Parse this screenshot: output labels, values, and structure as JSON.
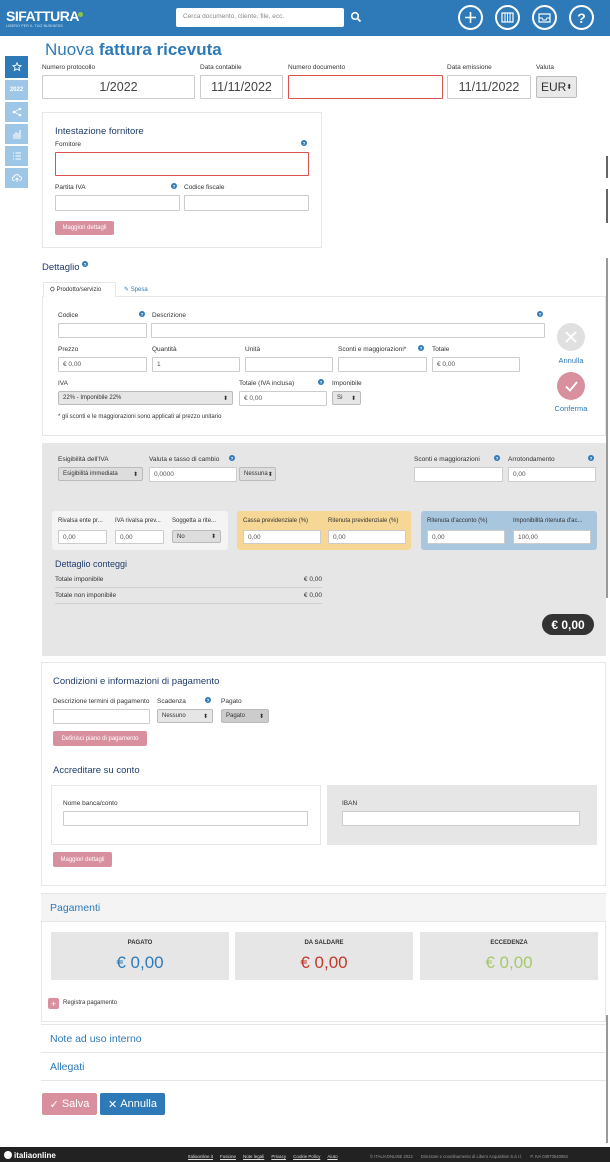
{
  "topbar": {
    "logo": "SIFATTURA",
    "tagline": "LIBERO PER IL TUO BUSINESS",
    "search_placeholder": "Cerca documento, cliente, file, ecc."
  },
  "sidebar": {
    "year": "2022"
  },
  "page": {
    "title_light": "Nuova ",
    "title_bold": "fattura ricevuta"
  },
  "header_fields": {
    "protocol_label": "Numero protocollo",
    "protocol_value": "1/2022",
    "accounting_date_label": "Data contabile",
    "accounting_date_value": "11/11/2022",
    "doc_number_label": "Numero documento",
    "doc_number_value": "",
    "issue_date_label": "Data emissione",
    "issue_date_value": "11/11/2022",
    "currency_label": "Valuta",
    "currency_value": "EUR"
  },
  "supplier": {
    "title": "Intestazione fornitore",
    "supplier_label": "Fornitore",
    "vat_label": "Partita IVA",
    "tax_code_label": "Codice fiscale",
    "more_button": "Maggiori dettagli"
  },
  "detail": {
    "title": "Dettaglio",
    "tab_product": "Prodotto/servizio",
    "tab_expense": "Spesa",
    "code_label": "Codice",
    "desc_label": "Descrizione",
    "price_label": "Prezzo",
    "price_value": "€ 0,00",
    "qty_label": "Quantità",
    "qty_value": "1",
    "unit_label": "Unità",
    "discount_label": "Sconti e maggiorazioni*",
    "total_label": "Totale",
    "total_value": "€ 0,00",
    "vat_label": "IVA",
    "vat_value": "22% - Imponibile 22%",
    "total_vat_label": "Totale (IVA inclusa)",
    "total_vat_value": "€ 0,00",
    "taxable_label": "Imponibile",
    "taxable_value": "Sì",
    "note": "* gli sconti e le maggiorazioni sono applicati al prezzo unitario",
    "cancel": "Annulla",
    "confirm": "Conferma"
  },
  "settings": {
    "vat_eligibility_label": "Esigibilità dell'IVA",
    "vat_eligibility_value": "Esigibilità immediata",
    "currency_rate_label": "Valuta e tasso di cambio",
    "currency_rate_value": "0,0000",
    "currency_select": "Nessuna",
    "discounts_label": "Sconti e maggiorazioni",
    "rounding_label": "Arrotondamento",
    "rounding_value": "0,00",
    "rivalsa_label": "Rivalsa ente pr...",
    "rivalsa_value": "0,00",
    "iva_rivalsa_label": "IVA rivalsa prev...",
    "iva_rivalsa_value": "0,00",
    "soggetta_label": "Soggetta a rite...",
    "soggetta_value": "No",
    "cassa_label": "Cassa previdenziale (%)",
    "cassa_value": "0,00",
    "rit_prev_label": "Ritenuta previdenziale (%)",
    "rit_prev_value": "0,00",
    "rit_acconto_label": "Ritenuta d'acconto (%)",
    "rit_acconto_value": "0,00",
    "imponibilita_label": "Imponibilità ritenuta d'ac...",
    "imponibilita_value": "100,00"
  },
  "summary": {
    "title": "Dettaglio conteggi",
    "taxable_label": "Totale imponibile",
    "taxable_value": "€ 0,00",
    "non_taxable_label": "Totale non imponibile",
    "non_taxable_value": "€ 0,00",
    "grand_total": "€ 0,00"
  },
  "payment": {
    "title": "Condizioni e informazioni di pagamento",
    "terms_label": "Descrizione termini di pagamento",
    "deadline_label": "Scadenza",
    "deadline_value": "Nessuno",
    "paid_label": "Pagato",
    "paid_value": "Pagato",
    "plan_button": "Definisci piano di pagamento",
    "account_title": "Accreditare su conto",
    "bank_label": "Nome banca/conto",
    "iban_label": "IBAN",
    "more_button": "Maggiori dettagli"
  },
  "payments": {
    "title": "Pagamenti",
    "paid_title": "PAGATO",
    "paid_value": "€ 0,00",
    "to_pay_title": "DA SALDARE",
    "to_pay_value": "€ 0,00",
    "excess_title": "ECCEDENZA",
    "excess_value": "€ 0,00",
    "register": "Registra pagamento"
  },
  "sections": {
    "notes": "Note ad uso interno",
    "attachments": "Allegati"
  },
  "actions": {
    "save": "Salva",
    "cancel": "Annulla"
  },
  "footer": {
    "brand": "italiaonline",
    "links": [
      "Italiaonline.it",
      "Fusione",
      "Note legali",
      "Privacy",
      "Cookie Policy",
      "Aiuto"
    ],
    "copyright": "© ITALIAONLINE 2022",
    "company": "Direzione e coordinamento di Libero Acquisition S.à r.l.",
    "vat": "P. IVA 03970540963"
  },
  "colors": {
    "primary": "#2e7ab8",
    "pink": "#d9909e",
    "danger": "#c0392b",
    "success": "#a5c96a"
  }
}
